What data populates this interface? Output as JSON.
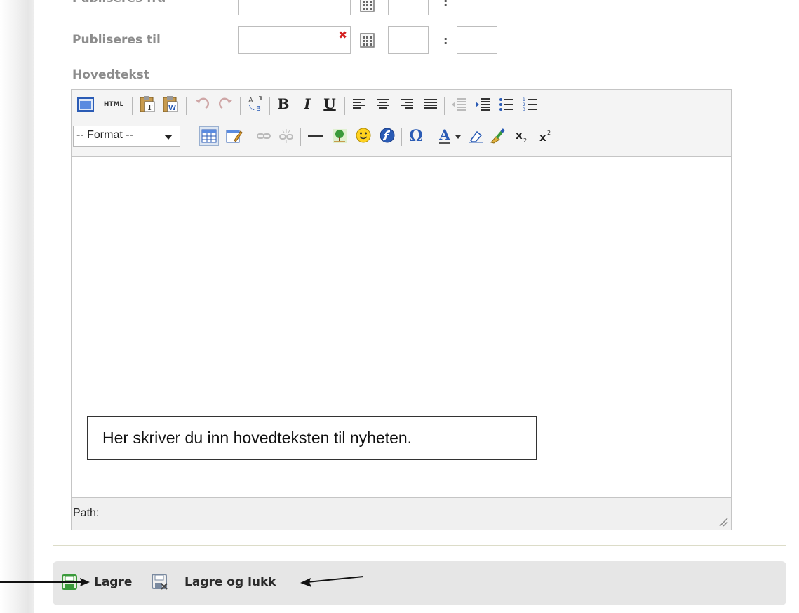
{
  "form": {
    "publish_from_label": "Publiseres fra",
    "publish_to_label": "Publiseres til",
    "main_text_label": "Hovedtekst",
    "time_separator": ":"
  },
  "editor": {
    "toolbar": {
      "html_label": "HTML",
      "format_select_value": "-- Format --",
      "bold_label": "B",
      "italic_label": "I",
      "underline_label": "U",
      "omega_label": "Ω",
      "text_color_label": "A"
    },
    "path_label": "Path:"
  },
  "callout": {
    "text": "Her skriver du inn hovedteksten til nyheten."
  },
  "actions": {
    "save_label": "Lagre",
    "save_and_close_label": "Lagre og lukk"
  },
  "colors": {
    "label_gray": "#8c8c8c",
    "clear_red": "#d42020",
    "save_green": "#3a9a3a"
  }
}
